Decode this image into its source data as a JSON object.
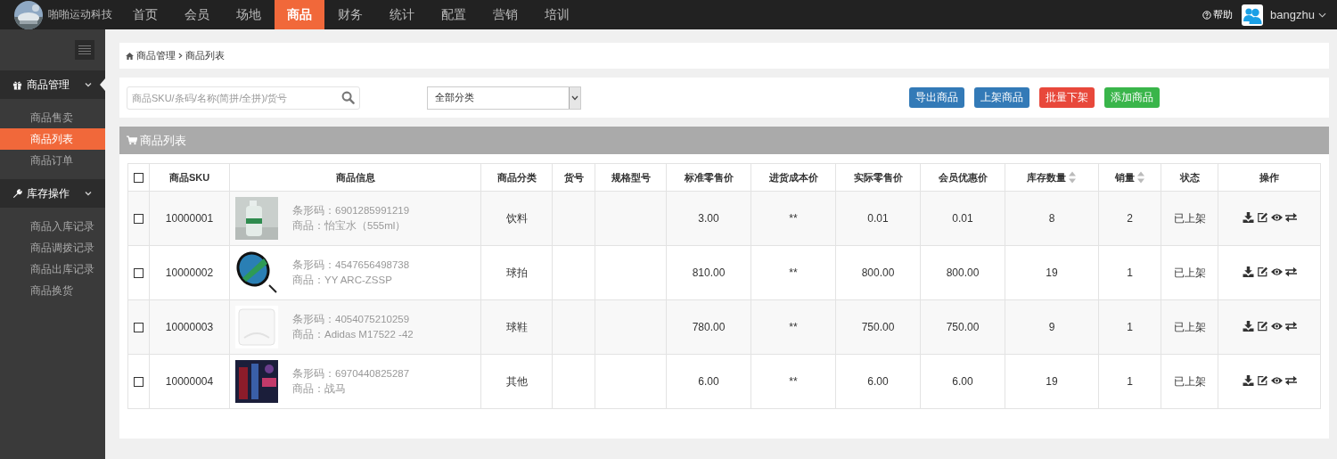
{
  "brand": {
    "name": "啪啪运动科技"
  },
  "nav": [
    {
      "label": "首页",
      "selected": false
    },
    {
      "label": "会员",
      "selected": false
    },
    {
      "label": "场地",
      "selected": false
    },
    {
      "label": "商品",
      "selected": true
    },
    {
      "label": "财务",
      "selected": false
    },
    {
      "label": "统计",
      "selected": false
    },
    {
      "label": "配置",
      "selected": false
    },
    {
      "label": "营销",
      "selected": false
    },
    {
      "label": "培训",
      "selected": false
    }
  ],
  "help": "帮助",
  "user": {
    "name": "bangzhu"
  },
  "sidebar": {
    "groups": [
      {
        "label": "商品管理",
        "kind": "gift",
        "expanded": true,
        "items": [
          {
            "label": "商品售卖",
            "selected": false
          },
          {
            "label": "商品列表",
            "selected": true
          },
          {
            "label": "商品订单",
            "selected": false
          }
        ]
      },
      {
        "label": "库存操作",
        "kind": "wrench",
        "expanded": true,
        "items": [
          {
            "label": "商品入库记录",
            "selected": false
          },
          {
            "label": "商品调拨记录",
            "selected": false
          },
          {
            "label": "商品出库记录",
            "selected": false
          },
          {
            "label": "商品换货",
            "selected": false
          }
        ]
      }
    ]
  },
  "breadcrumb": [
    "商品管理",
    "商品列表"
  ],
  "toolbar": {
    "search": {
      "placeholder": "商品SKU/条码/名称(简拼/全拼)/货号"
    },
    "category": {
      "value": "全部分类"
    },
    "buttons": [
      {
        "label": "导出商品",
        "color": "#337ab7"
      },
      {
        "label": "上架商品",
        "color": "#337ab7"
      },
      {
        "label": "批量下架",
        "color": "#e8483b"
      },
      {
        "label": "添加商品",
        "color": "#39b54a"
      }
    ]
  },
  "panel": {
    "title": "商品列表",
    "all_checked": false,
    "columns": [
      {
        "label": "商品SKU",
        "sortable": false
      },
      {
        "label": "商品信息",
        "sortable": false
      },
      {
        "label": "商品分类",
        "sortable": false
      },
      {
        "label": "货号",
        "sortable": false
      },
      {
        "label": "规格型号",
        "sortable": false
      },
      {
        "label": "标准零售价",
        "sortable": false
      },
      {
        "label": "进货成本价",
        "sortable": false
      },
      {
        "label": "实际零售价",
        "sortable": false
      },
      {
        "label": "会员优惠价",
        "sortable": false
      },
      {
        "label": "库存数量",
        "sortable": true
      },
      {
        "label": "销量",
        "sortable": true
      },
      {
        "label": "状态",
        "sortable": false
      },
      {
        "label": "操作",
        "sortable": false
      }
    ],
    "rows": [
      {
        "checked": false,
        "sku": "10000001",
        "barcode": "条形码：6901285991219",
        "product": "商品：怡宝水（555ml）",
        "category": "饮料",
        "std_price": "3.00",
        "cost": "**",
        "actual_price": "0.01",
        "member_price": "0.01",
        "stock": "8",
        "sales": "2",
        "status": "已上架"
      },
      {
        "checked": false,
        "sku": "10000002",
        "barcode": "条形码：4547656498738",
        "product": "商品：YY ARC-ZSSP",
        "category": "球拍",
        "std_price": "810.00",
        "cost": "**",
        "actual_price": "800.00",
        "member_price": "800.00",
        "stock": "19",
        "sales": "1",
        "status": "已上架"
      },
      {
        "checked": false,
        "sku": "10000003",
        "barcode": "条形码：4054075210259",
        "product": "商品：Adidas M17522 -42",
        "category": "球鞋",
        "std_price": "780.00",
        "cost": "**",
        "actual_price": "750.00",
        "member_price": "750.00",
        "stock": "9",
        "sales": "1",
        "status": "已上架"
      },
      {
        "checked": false,
        "sku": "10000004",
        "barcode": "条形码：6970440825287",
        "product": "商品：战马",
        "category": "其他",
        "std_price": "6.00",
        "cost": "**",
        "actual_price": "6.00",
        "member_price": "6.00",
        "stock": "19",
        "sales": "1",
        "status": "已上架"
      }
    ]
  }
}
